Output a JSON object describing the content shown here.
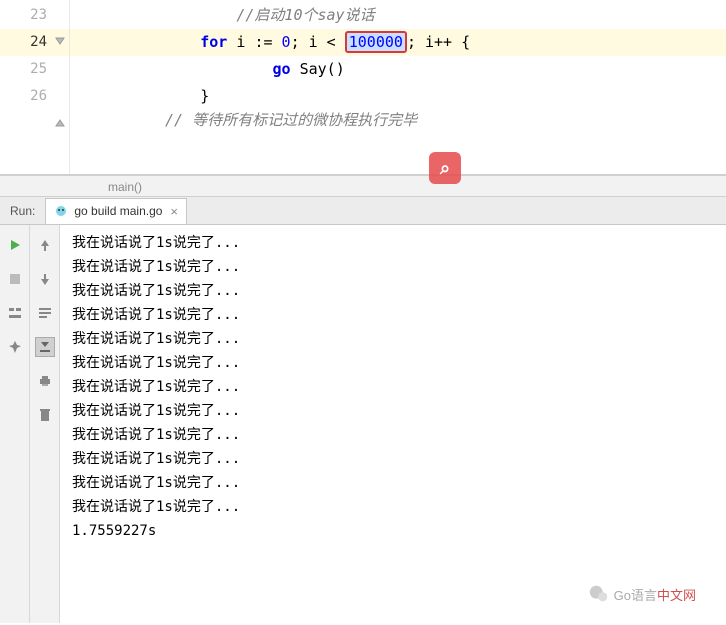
{
  "editor": {
    "lines": [
      {
        "num": "23",
        "type": "comment",
        "indent": "            ",
        "text": "//启动10个say说话"
      },
      {
        "num": "24",
        "type": "for",
        "indent": "        ",
        "kw1": "for",
        "var": "i",
        "assign": ":=",
        "zero": "0",
        "cond": "i <",
        "limit": "100000",
        "post": "; i++ {"
      },
      {
        "num": "25",
        "type": "call",
        "indent": "                ",
        "kw": "go",
        "fn": "Say()"
      },
      {
        "num": "26",
        "type": "close",
        "indent": "        ",
        "text": "}"
      }
    ],
    "cutoff": "// 等待所有标记过的微协程执行完毕"
  },
  "breadcrumb": "main()",
  "run": {
    "label": "Run:",
    "tab_title": "go build main.go",
    "tab_close": "×"
  },
  "console": {
    "lines": [
      "我在说话说了1s说完了...",
      "我在说话说了1s说完了...",
      "我在说话说了1s说完了...",
      "我在说话说了1s说完了...",
      "我在说话说了1s说完了...",
      "我在说话说了1s说完了...",
      "我在说话说了1s说完了...",
      "我在说话说了1s说完了...",
      "我在说话说了1s说完了...",
      "我在说话说了1s说完了...",
      "我在说话说了1s说完了...",
      "我在说话说了1s说完了...",
      "1.7559227s"
    ]
  },
  "footer": {
    "text1": "Go语言",
    "text2": "中文网"
  }
}
